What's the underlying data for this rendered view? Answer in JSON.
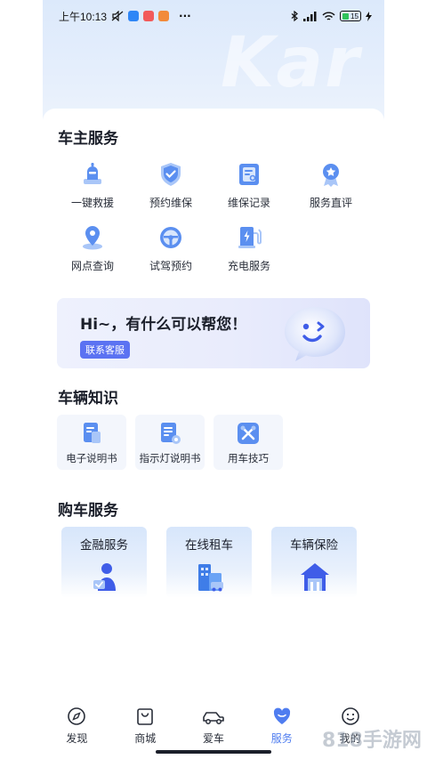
{
  "status_bar": {
    "time": "上午10:13",
    "battery": "15",
    "more": "···"
  },
  "hero": {
    "watermark": "Kar"
  },
  "owner_services": {
    "title": "车主服务",
    "items": [
      {
        "label": "一键救援",
        "icon": "rescue-icon"
      },
      {
        "label": "预约维保",
        "icon": "shield-check-icon"
      },
      {
        "label": "维保记录",
        "icon": "record-icon"
      },
      {
        "label": "服务直评",
        "icon": "medal-icon"
      },
      {
        "label": "网点查询",
        "icon": "location-pin-icon"
      },
      {
        "label": "试驾预约",
        "icon": "steering-wheel-icon"
      },
      {
        "label": "充电服务",
        "icon": "charging-icon"
      }
    ]
  },
  "banner": {
    "text": "Hi~，有什么可以帮您！",
    "button": "联系客服"
  },
  "vehicle_knowledge": {
    "title": "车辆知识",
    "items": [
      {
        "label": "电子说明书",
        "icon": "manual-icon"
      },
      {
        "label": "指示灯说明书",
        "icon": "indicator-doc-icon"
      },
      {
        "label": "用车技巧",
        "icon": "tools-icon"
      }
    ]
  },
  "purchase_services": {
    "title": "购车服务",
    "items": [
      {
        "label": "金融服务",
        "icon": "finance-person-icon"
      },
      {
        "label": "在线租车",
        "icon": "rental-building-icon"
      },
      {
        "label": "车辆保险",
        "icon": "insurance-house-icon"
      }
    ]
  },
  "tabbar": {
    "active": "服务",
    "items": [
      {
        "label": "发现",
        "icon": "compass-icon"
      },
      {
        "label": "商城",
        "icon": "shopping-bag-icon"
      },
      {
        "label": "爱车",
        "icon": "car-icon"
      },
      {
        "label": "服务",
        "icon": "heart-service-icon"
      },
      {
        "label": "我的",
        "icon": "smile-face-icon"
      }
    ]
  },
  "overlay_watermark": "818手游网",
  "colors": {
    "accent": "#4f7df0",
    "icon_blue": "#5b8ff0",
    "icon_light": "#a9c6f8",
    "banner_button": "#5b72f2"
  }
}
